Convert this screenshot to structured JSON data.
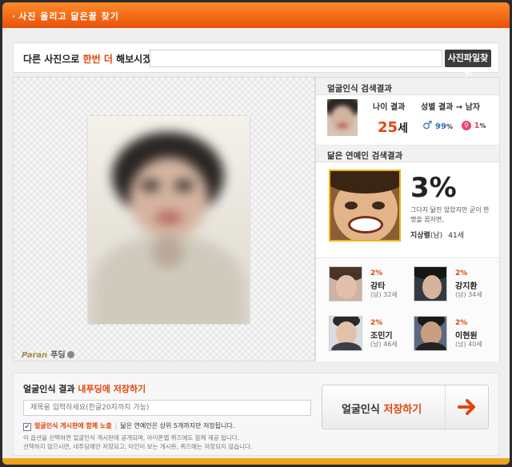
{
  "title": "사진 올리고 닮은꼴 찾기",
  "search": {
    "prompt_prefix": "다른 사진으로 ",
    "prompt_highlight": "한번 더",
    "prompt_suffix": " 해보시겠어요?",
    "button_label": "사진파일찾기"
  },
  "photo": {
    "watermark_brand": "Paran",
    "watermark_text": "푸딩"
  },
  "face_result": {
    "heading": "얼굴인식 검색결과",
    "age_label": "나이 결과",
    "age_value": "25",
    "age_unit": "세",
    "gender_label": "성별 결과",
    "gender_arrow": "→",
    "gender_result": "남자",
    "male_pct": "99",
    "female_pct": "1",
    "pct_sign": "%"
  },
  "celebrity": {
    "heading": "닮은 연예인 검색결과",
    "top_match": {
      "pct": "3%",
      "desc": "그다지 닮진 않았지만 굳이 한 명을 꼽자면,",
      "name": "지상렬",
      "gender": "(남)",
      "age": "41세"
    },
    "others": [
      {
        "pct": "2%",
        "name": "강타",
        "meta": "(남) 32세"
      },
      {
        "pct": "2%",
        "name": "강지환",
        "meta": "(남) 34세"
      },
      {
        "pct": "2%",
        "name": "조민기",
        "meta": "(남) 46세"
      },
      {
        "pct": "2%",
        "name": "이현원",
        "meta": "(남) 40세"
      }
    ]
  },
  "save": {
    "heading_prefix": "얼굴인식 결과 ",
    "heading_highlight": "내푸딩에 저장하기",
    "input_placeholder": "제목을 입력하세요(한글20자까지 가능)",
    "check_label": "얼굴인식 게시판에 함께 노출",
    "check_note": "닮은 연예인은 상위 5개까지만 저장됩니다.",
    "notice_line1": "이 옵션을 선택하면 얼굴인식 게시판에 공개되며, 아이폰앱 퀴즈에도 함께 제공 됩니다.",
    "notice_line2": "선택하지 않으시면, 내푸딩에만 저장되고, 타인이 보는 게시판, 퀴즈에는 저장되지 않습니다.",
    "button_prefix": "얼굴인식 ",
    "button_highlight": "저장하기"
  },
  "colors": {
    "accent": "#e2440a",
    "title_bar": "#f06818",
    "highlight_frame": "#f1b01a",
    "male": "#2a6dc4",
    "female": "#e8456b"
  },
  "icons": {
    "male": "male-symbol",
    "female": "female-symbol",
    "arrow": "right-arrow"
  }
}
